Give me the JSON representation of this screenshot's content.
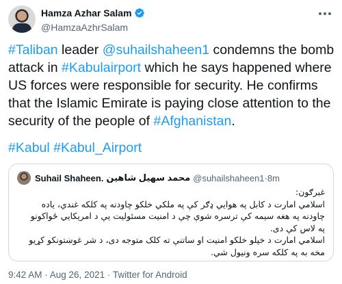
{
  "tweet": {
    "author": {
      "display_name": "Hamza Azhar Salam",
      "handle": "@HamzaAzhrSalam",
      "verified": true
    },
    "body": {
      "tag_taliban": "#Taliban",
      "t1": " leader ",
      "mention": "@suhailshaheen1",
      "t2": " condemns the bomb attack in ",
      "tag_kabulairport": "#Kabulairport",
      "t3": " which he says happened where US forces were responsible for security. He confirms that the Islamic Emirate is paying close attention to the security of the people of ",
      "tag_afghanistan": "#Afghanistan",
      "t4": "."
    },
    "hashtags": {
      "kabul": "#Kabul",
      "kabul_airport": "#Kabul_Airport"
    },
    "quoted": {
      "name": "Suhail Shaheen.",
      "name_rtl": "محمد سهيل شاهين",
      "handle": "@suhailshaheen1",
      "separator": " · ",
      "time": "8m",
      "lines": [
        "غبرګون:",
        "اسلامي امارت د کابل په هوايي ډګر کې په ملکي خلکو چاودنه په کلکه غندي، ياده",
        "چاودنه په هغه سيمه کې ترسره شوې چې د امنيت مسئوليت يې د امريکايي ځواکونو",
        "په لاس کې دی.",
        "اسلامي امارت د خپلو خلکو امنيت او ساتنې ته کلک متوجه دی، د شر غوښتونکو کړيو",
        "مخه به په کلکه سره ونيول شي."
      ]
    },
    "meta": "9:42 AM · Aug 26, 2021 · Twitter for Android",
    "colors": {
      "link": "#1d9bf0",
      "text": "#0f1419",
      "secondary": "#536471",
      "border": "#cfd9de"
    },
    "icons": {
      "verified": "verified-badge-icon",
      "more": "more-options-icon"
    }
  }
}
